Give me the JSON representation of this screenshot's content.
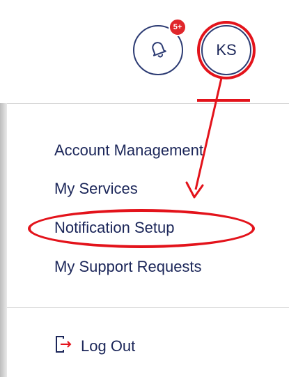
{
  "header": {
    "notification_badge": "5+",
    "avatar_initials": "KS"
  },
  "menu": {
    "items": [
      {
        "label": "Account Management"
      },
      {
        "label": "My Services"
      },
      {
        "label": "Notification Setup"
      },
      {
        "label": "My Support Requests"
      }
    ],
    "logout_label": "Log Out"
  },
  "colors": {
    "text": "#1b2659",
    "accent": "#e3131b",
    "badge": "#e0262b",
    "border": "#2c3b73"
  },
  "icons": [
    "bell-icon",
    "logout-icon"
  ]
}
